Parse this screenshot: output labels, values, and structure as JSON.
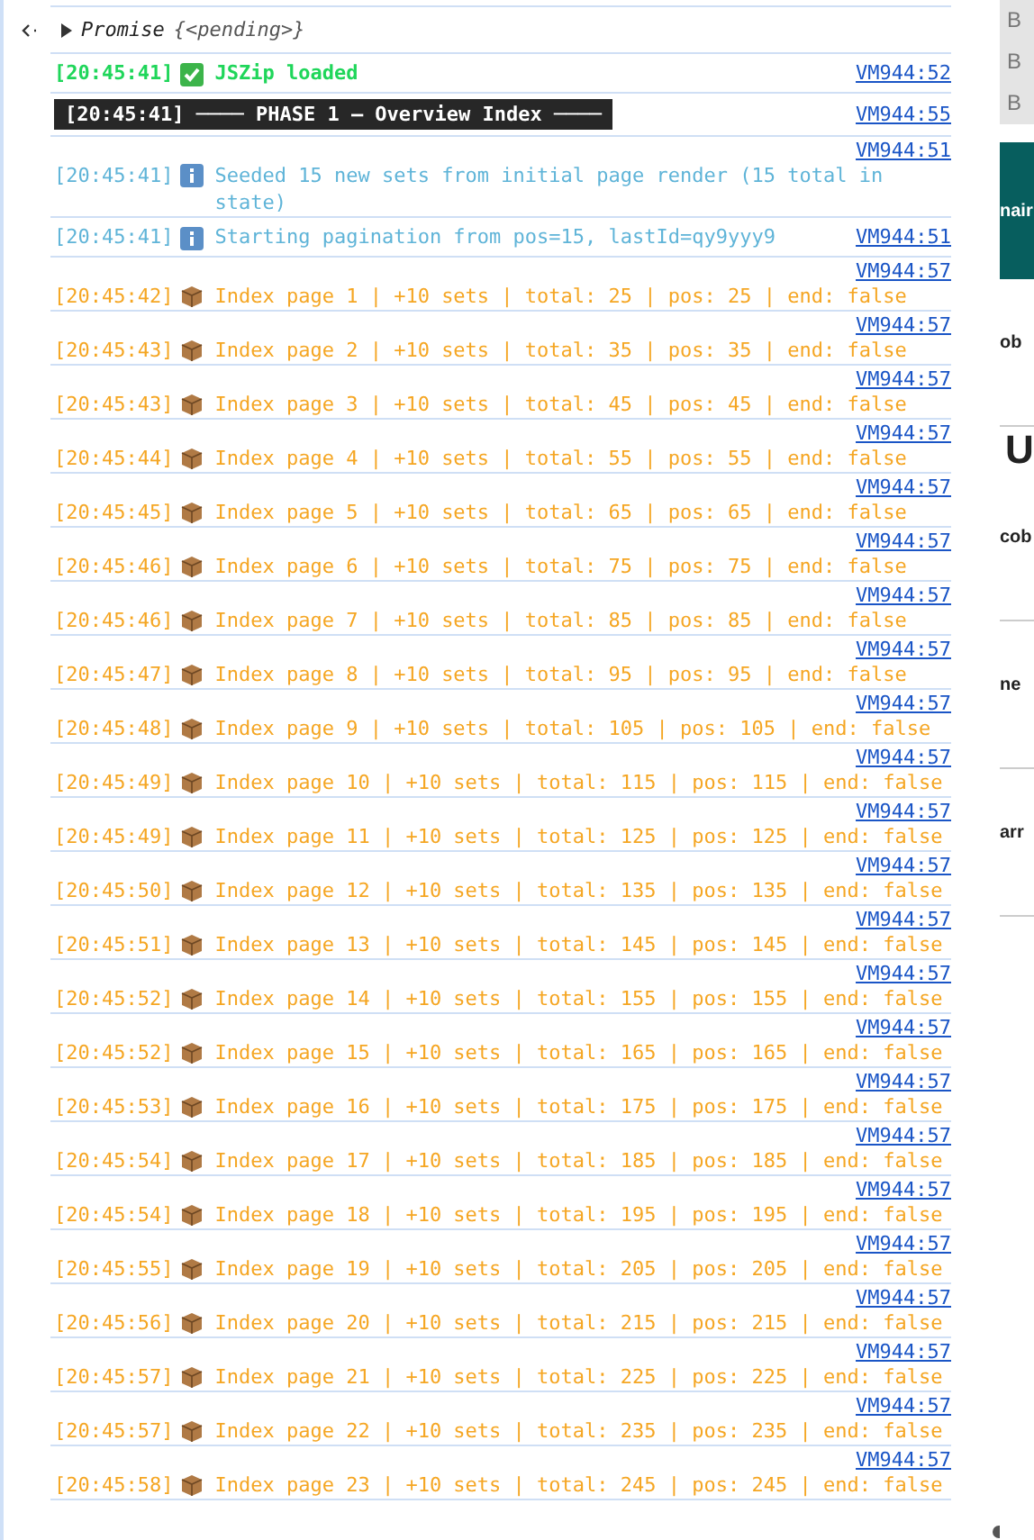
{
  "console": {
    "entries": [
      {
        "kind": "promise",
        "label": "Promise",
        "value": "{<pending>}"
      },
      {
        "kind": "success",
        "time": "[20:45:41]",
        "message": "JSZip loaded",
        "source": "VM944:52",
        "link_above": false
      },
      {
        "kind": "phase",
        "message": "[20:45:41] ──── PHASE 1 — Overview Index ────",
        "source": "VM944:55"
      },
      {
        "kind": "info",
        "time": "[20:45:41]",
        "message": "Seeded 15 new sets from initial page render (15 total in state)",
        "source": "VM944:51",
        "link_above": true
      },
      {
        "kind": "info",
        "time": "[20:45:41]",
        "message": "Starting pagination from pos=15, lastId=qy9yyy9",
        "source": "VM944:51",
        "link_above": false
      },
      {
        "kind": "index",
        "time": "[20:45:42]",
        "message": "Index page 1 | +10 sets | total: 25 | pos: 25 | end: false",
        "source": "VM944:57",
        "link_above": true
      },
      {
        "kind": "index",
        "time": "[20:45:43]",
        "message": "Index page 2 | +10 sets | total: 35 | pos: 35 | end: false",
        "source": "VM944:57",
        "link_above": true
      },
      {
        "kind": "index",
        "time": "[20:45:43]",
        "message": "Index page 3 | +10 sets | total: 45 | pos: 45 | end: false",
        "source": "VM944:57",
        "link_above": true
      },
      {
        "kind": "index",
        "time": "[20:45:44]",
        "message": "Index page 4 | +10 sets | total: 55 | pos: 55 | end: false",
        "source": "VM944:57",
        "link_above": true
      },
      {
        "kind": "index",
        "time": "[20:45:45]",
        "message": "Index page 5 | +10 sets | total: 65 | pos: 65 | end: false",
        "source": "VM944:57",
        "link_above": true
      },
      {
        "kind": "index",
        "time": "[20:45:46]",
        "message": "Index page 6 | +10 sets | total: 75 | pos: 75 | end: false",
        "source": "VM944:57",
        "link_above": true
      },
      {
        "kind": "index",
        "time": "[20:45:46]",
        "message": "Index page 7 | +10 sets | total: 85 | pos: 85 | end: false",
        "source": "VM944:57",
        "link_above": true
      },
      {
        "kind": "index",
        "time": "[20:45:47]",
        "message": "Index page 8 | +10 sets | total: 95 | pos: 95 | end: false",
        "source": "VM944:57",
        "link_above": true
      },
      {
        "kind": "index",
        "time": "[20:45:48]",
        "message": "Index page 9 | +10 sets | total: 105 | pos: 105 | end: false",
        "source": "VM944:57",
        "link_above": true
      },
      {
        "kind": "index",
        "time": "[20:45:49]",
        "message": "Index page 10 | +10 sets | total: 115 | pos: 115 | end: false",
        "source": "VM944:57",
        "link_above": true
      },
      {
        "kind": "index",
        "time": "[20:45:49]",
        "message": "Index page 11 | +10 sets | total: 125 | pos: 125 | end: false",
        "source": "VM944:57",
        "link_above": true
      },
      {
        "kind": "index",
        "time": "[20:45:50]",
        "message": "Index page 12 | +10 sets | total: 135 | pos: 135 | end: false",
        "source": "VM944:57",
        "link_above": true
      },
      {
        "kind": "index",
        "time": "[20:45:51]",
        "message": "Index page 13 | +10 sets | total: 145 | pos: 145 | end: false",
        "source": "VM944:57",
        "link_above": true
      },
      {
        "kind": "index",
        "time": "[20:45:52]",
        "message": "Index page 14 | +10 sets | total: 155 | pos: 155 | end: false",
        "source": "VM944:57",
        "link_above": true
      },
      {
        "kind": "index",
        "time": "[20:45:52]",
        "message": "Index page 15 | +10 sets | total: 165 | pos: 165 | end: false",
        "source": "VM944:57",
        "link_above": true
      },
      {
        "kind": "index",
        "time": "[20:45:53]",
        "message": "Index page 16 | +10 sets | total: 175 | pos: 175 | end: false",
        "source": "VM944:57",
        "link_above": true
      },
      {
        "kind": "index",
        "time": "[20:45:54]",
        "message": "Index page 17 | +10 sets | total: 185 | pos: 185 | end: false",
        "source": "VM944:57",
        "link_above": true
      },
      {
        "kind": "index",
        "time": "[20:45:54]",
        "message": "Index page 18 | +10 sets | total: 195 | pos: 195 | end: false",
        "source": "VM944:57",
        "link_above": true
      },
      {
        "kind": "index",
        "time": "[20:45:55]",
        "message": "Index page 19 | +10 sets | total: 205 | pos: 205 | end: false",
        "source": "VM944:57",
        "link_above": true
      },
      {
        "kind": "index",
        "time": "[20:45:56]",
        "message": "Index page 20 | +10 sets | total: 215 | pos: 215 | end: false",
        "source": "VM944:57",
        "link_above": true
      },
      {
        "kind": "index",
        "time": "[20:45:57]",
        "message": "Index page 21 | +10 sets | total: 225 | pos: 225 | end: false",
        "source": "VM944:57",
        "link_above": true
      },
      {
        "kind": "index",
        "time": "[20:45:57]",
        "message": "Index page 22 | +10 sets | total: 235 | pos: 235 | end: false",
        "source": "VM944:57",
        "link_above": true
      },
      {
        "kind": "index",
        "time": "[20:45:58]",
        "message": "Index page 23 | +10 sets | total: 245 | pos: 245 | end: false",
        "source": "VM944:57",
        "link_above": true
      }
    ]
  },
  "background_page": {
    "fragments": [
      {
        "kind": "letter",
        "text": "B"
      },
      {
        "kind": "letter",
        "text": "B"
      },
      {
        "kind": "letter",
        "text": "B"
      },
      {
        "kind": "banner",
        "text": "nair"
      },
      {
        "kind": "text",
        "text": "ob"
      },
      {
        "kind": "big",
        "text": "U"
      },
      {
        "kind": "text",
        "text": "cob"
      },
      {
        "kind": "text",
        "text": "ne"
      },
      {
        "kind": "text",
        "text": "arr"
      }
    ]
  }
}
